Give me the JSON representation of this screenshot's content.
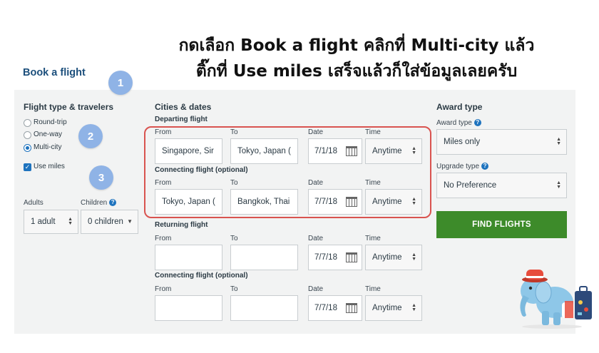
{
  "caption": {
    "line1": "กดเลือก Book a flight คลิกที่ Multi-city แล้ว",
    "line2": "ติ๊กที่ Use miles เสร็จแล้วก็ใส่ข้อมูลเลยครับ"
  },
  "page_title": "Book a flight",
  "badges": [
    "1",
    "2",
    "3"
  ],
  "flight_type": {
    "heading": "Flight type & travelers",
    "options": [
      "Round-trip",
      "One-way",
      "Multi-city"
    ],
    "selected": "Multi-city",
    "use_miles_label": "Use miles",
    "use_miles_checked": true
  },
  "travelers": {
    "adults_label": "Adults",
    "adults_value": "1 adult",
    "children_label": "Children",
    "children_value": "0 children"
  },
  "cities": {
    "heading": "Cities & dates",
    "col_from": "From",
    "col_to": "To",
    "col_date": "Date",
    "col_time": "Time",
    "segments": [
      {
        "title": "Departing flight",
        "from": "Singapore, Sir",
        "to": "Tokyo, Japan (",
        "date": "7/1/18",
        "time": "Anytime"
      },
      {
        "title": "Connecting flight (optional)",
        "from": "Tokyo, Japan (",
        "to": "Bangkok, Thai",
        "date": "7/7/18",
        "time": "Anytime"
      },
      {
        "title": "Returning flight",
        "from": "",
        "to": "",
        "date": "7/7/18",
        "time": "Anytime"
      },
      {
        "title": "Connecting flight (optional)",
        "from": "",
        "to": "",
        "date": "7/7/18",
        "time": "Anytime"
      }
    ]
  },
  "award": {
    "heading": "Award type",
    "award_type_label": "Award type",
    "award_type_value": "Miles only",
    "upgrade_type_label": "Upgrade type",
    "upgrade_type_value": "No Preference",
    "find_button": "FIND FLIGHTS"
  },
  "colors": {
    "accent_blue": "#1e73be",
    "title_blue": "#1c4f7c",
    "badge": "#8fb3e6",
    "highlight_red": "#d9534f",
    "button_green": "#3d8b2a",
    "panel_bg": "#f2f3f3"
  },
  "icons": {
    "calendar": "calendar-icon",
    "select_arrows": "select-arrows-icon",
    "info": "info-icon",
    "mascot": "elephant-mascot"
  }
}
